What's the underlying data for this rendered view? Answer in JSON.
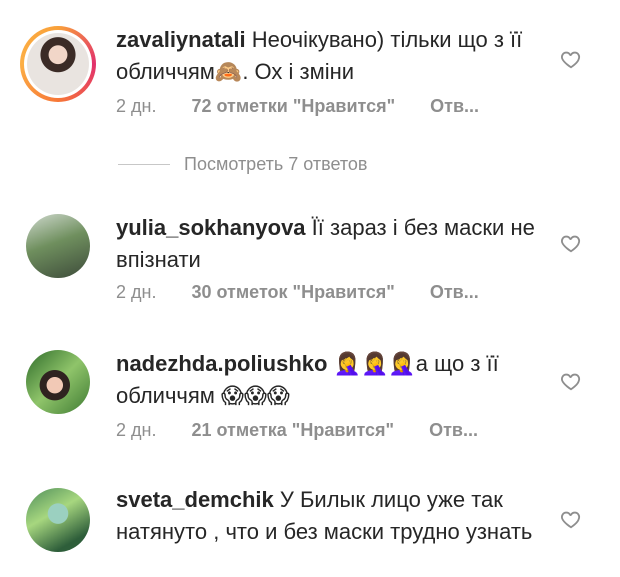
{
  "comments": [
    {
      "username": "zavaliynatali",
      "text": "Неочікувано) тільки що з її обличчям🙈. Ох і зміни",
      "time": "2 дн.",
      "likes": "72 отметки \"Нравится\"",
      "reply": "Отв..."
    },
    {
      "username": "yulia_sokhanyova",
      "text": "Її зараз і без маски не впізнати",
      "time": "2 дн.",
      "likes": "30 отметок \"Нравится\"",
      "reply": "Отв..."
    },
    {
      "username": "nadezhda.poliushko",
      "text": "🤦‍♀️🤦‍♀️🤦‍♀️а що з її обличчям 😱😱😱",
      "time": "2 дн.",
      "likes": "21 отметка \"Нравится\"",
      "reply": "Отв..."
    },
    {
      "username": "sveta_demchik",
      "text": "У Билык лицо уже так натянуто , что и без маски трудно узнать",
      "time": "",
      "likes": "",
      "reply": ""
    }
  ],
  "view_replies": "Посмотреть 7 ответов",
  "icons": {
    "like": "heart-outline-icon"
  }
}
